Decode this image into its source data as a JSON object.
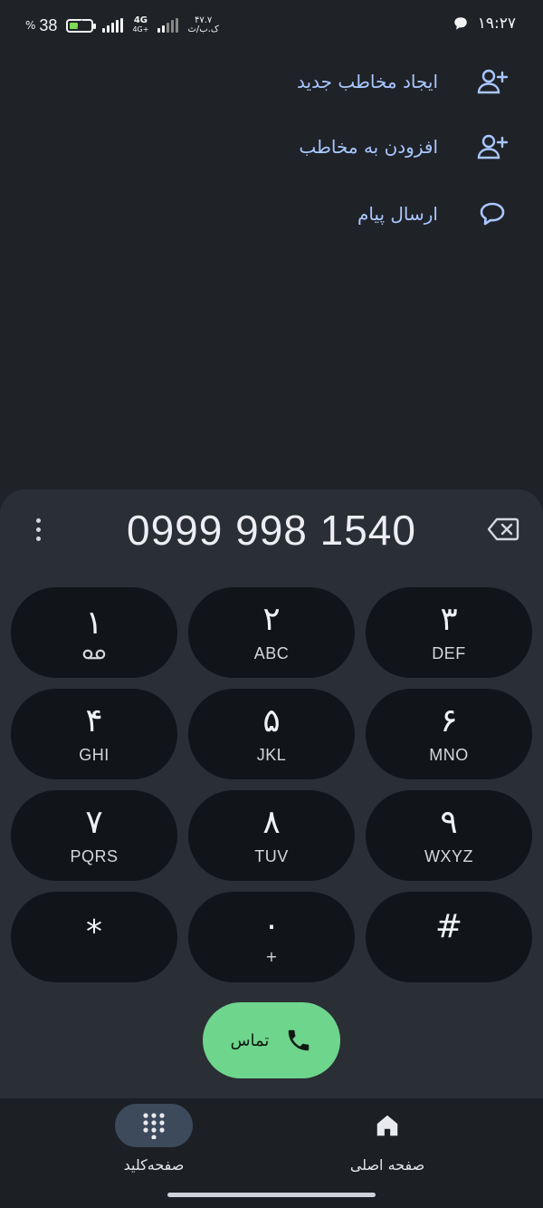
{
  "status_bar": {
    "time": "۱۹:۲۷",
    "battery_level": "38",
    "percent_sign": "%",
    "network": "4G",
    "network_sub": "4G+",
    "speed_value": "۴۷.۷",
    "speed_unit": "ک.ب/ث",
    "battery_fill": 0.38
  },
  "actions": [
    {
      "label": "ایجاد مخاطب جدید",
      "icon": "add-contact-icon"
    },
    {
      "label": "افزودن به مخاطب",
      "icon": "add-to-contact-icon"
    },
    {
      "label": "ارسال پیام",
      "icon": "message-icon"
    }
  ],
  "dialer": {
    "number": "0999 998 1540",
    "keys": [
      {
        "digit": "۱",
        "sub": "voicemail-icon"
      },
      {
        "digit": "۲",
        "sub": "ABC"
      },
      {
        "digit": "۳",
        "sub": "DEF"
      },
      {
        "digit": "۴",
        "sub": "GHI"
      },
      {
        "digit": "۵",
        "sub": "JKL"
      },
      {
        "digit": "۶",
        "sub": "MNO"
      },
      {
        "digit": "۷",
        "sub": "PQRS"
      },
      {
        "digit": "۸",
        "sub": "TUV"
      },
      {
        "digit": "۹",
        "sub": "WXYZ"
      },
      {
        "digit": "*",
        "sub": ""
      },
      {
        "digit": "۰",
        "sub": "+"
      },
      {
        "digit": "#",
        "sub": ""
      }
    ],
    "call_label": "تماس"
  },
  "nav": {
    "keypad_label": "صفحه‌کلید",
    "home_label": "صفحه اصلی",
    "active": "keypad"
  },
  "colors": {
    "background": "#1f2227",
    "panel": "#2a2e35",
    "key": "#111419",
    "accent_text": "#a9c7ff",
    "call_green": "#6ed58c",
    "nav_active": "#3d4a5c"
  }
}
